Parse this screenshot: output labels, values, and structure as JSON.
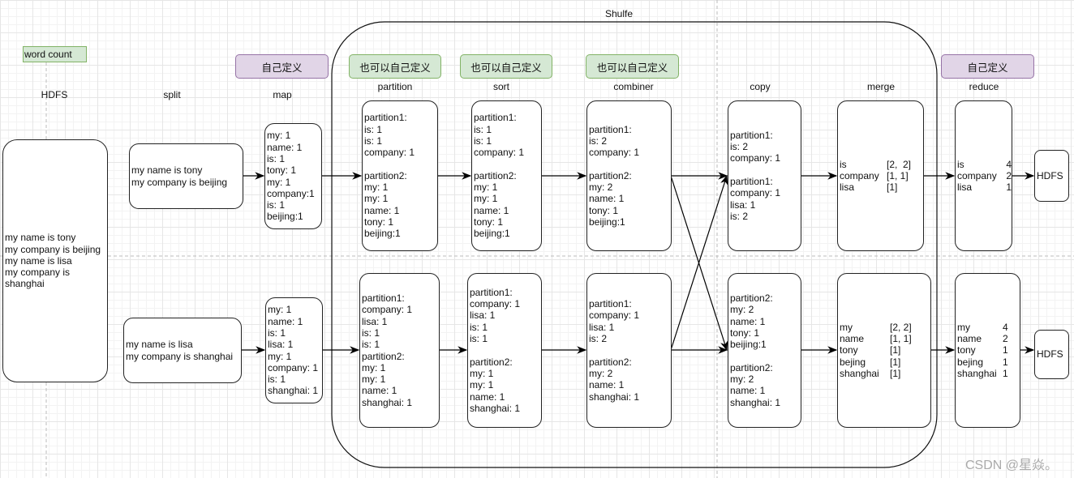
{
  "title": "word count",
  "shuffle_title": "Shulfe",
  "watermark": "CSDN @星焱。",
  "colors": {
    "tag_purple": "#e1d5e7",
    "tag_green": "#d5e8d4",
    "title_green": "#d5e8d4"
  },
  "tags": {
    "map": "自己定义",
    "partition": "也可以自己定义",
    "sort": "也可以自己定义",
    "combiner": "也可以自己定义",
    "reduce": "自己定义"
  },
  "stages": {
    "hdfs": "HDFS",
    "split": "split",
    "map": "map",
    "partition": "partition",
    "sort": "sort",
    "combiner": "combiner",
    "copy": "copy",
    "merge": "merge",
    "reduce": "reduce"
  },
  "boxes": {
    "hdfs_input": [
      "my name is tony",
      "my company is beijing",
      "my name is lisa",
      "my company is",
      "shanghai"
    ],
    "split1": [
      "my name is tony",
      "my company is beijing"
    ],
    "split2": [
      "my name is lisa",
      "my company is shanghai"
    ],
    "map1": [
      "my: 1",
      "name: 1",
      "is: 1",
      "tony: 1",
      "my: 1",
      "company:1",
      "is: 1",
      "beijing:1"
    ],
    "map2": [
      "my: 1",
      "name: 1",
      "is: 1",
      "lisa: 1",
      "my: 1",
      "company: 1",
      "is: 1",
      "shanghai: 1"
    ],
    "partition1": [
      "partition1:",
      "is: 1",
      "is: 1",
      "company: 1",
      " ",
      "partition2:",
      "my: 1",
      "my: 1",
      "name: 1",
      "tony: 1",
      "beijing:1"
    ],
    "partition2": [
      "partition1:",
      "company: 1",
      "lisa: 1",
      "is: 1",
      "is: 1",
      "partition2:",
      "my: 1",
      "my: 1",
      "name: 1",
      "shanghai: 1"
    ],
    "sort1": [
      "partition1:",
      "is: 1",
      "is: 1",
      "company: 1",
      " ",
      "partition2:",
      "my: 1",
      "my: 1",
      "name: 1",
      "tony: 1",
      "beijing:1"
    ],
    "sort2": [
      "partition1:",
      "company: 1",
      "lisa: 1",
      "is: 1",
      "is: 1",
      " ",
      "partition2:",
      "my: 1",
      "my: 1",
      "name: 1",
      "shanghai: 1"
    ],
    "combiner1": [
      "partition1:",
      "is: 2",
      "company: 1",
      " ",
      "partition2:",
      "my: 2",
      "name: 1",
      "tony: 1",
      "beijing:1"
    ],
    "combiner2": [
      "partition1:",
      "company: 1",
      "lisa: 1",
      "is: 2",
      " ",
      "partition2:",
      "my: 2",
      "name: 1",
      "shanghai: 1"
    ],
    "copy1": [
      "partition1:",
      "is: 2",
      "company: 1",
      " ",
      "partition1:",
      "company: 1",
      "lisa: 1",
      "is: 2"
    ],
    "copy2": [
      "partition2:",
      "my: 2",
      "name: 1",
      "tony: 1",
      "beijing:1",
      " ",
      "partition2:",
      "my: 2",
      "name: 1",
      "shanghai: 1"
    ]
  },
  "tables": {
    "merge1": [
      [
        "is",
        "[2,  2]"
      ],
      [
        "company",
        "[1, 1]"
      ],
      [
        "lisa",
        "[1]"
      ]
    ],
    "merge2": [
      [
        "my",
        "[2, 2]"
      ],
      [
        "name",
        "[1, 1]"
      ],
      [
        "tony",
        "[1]"
      ],
      [
        "bejing",
        "[1]"
      ],
      [
        "shanghai",
        "[1]"
      ]
    ],
    "reduce1": [
      [
        "is",
        "4"
      ],
      [
        "company",
        "2"
      ],
      [
        "lisa",
        "1"
      ]
    ],
    "reduce2": [
      [
        "my",
        "4"
      ],
      [
        "name",
        "2"
      ],
      [
        "tony",
        "1"
      ],
      [
        "bejing",
        "1"
      ],
      [
        "shanghai",
        "1"
      ]
    ]
  },
  "outputs": {
    "out1": "HDFS",
    "out2": "HDFS"
  }
}
